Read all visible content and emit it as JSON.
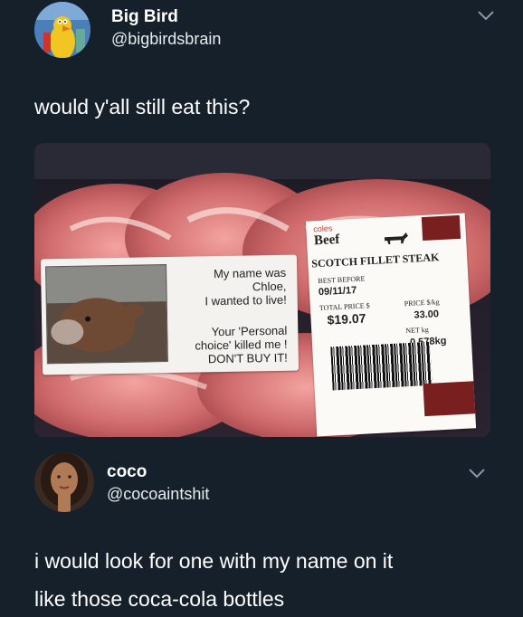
{
  "tweet1": {
    "name": "Big Bird",
    "handle": "@bigbirdsbrain",
    "text": "would y'all still eat this?",
    "avatar_icon": "big-bird-avatar-icon"
  },
  "photo": {
    "left_label": {
      "line1": "My name was",
      "line2": "Chloe,",
      "line3": "I wanted to live!",
      "line4": "Your 'Personal",
      "line5": "choice' killed me !",
      "line6": "DON'T BUY IT!"
    },
    "right_label": {
      "brand": "coles",
      "beef": "Beef",
      "product": "SCOTCH FILLET STEAK",
      "best_before_label": "BEST BEFORE",
      "best_before_date": "09/11/17",
      "total_price_label": "TOTAL PRICE $",
      "total_price": "$19.07",
      "price_per_kg_label": "PRICE $/kg",
      "price_per_kg": "33.00",
      "net_kg_label": "NET kg",
      "net_kg": "0.578kg"
    }
  },
  "tweet2": {
    "name": "coco",
    "handle": "@cocoaintshit",
    "text_line1": "i would look for one with my name on it",
    "text_line2": "like those coca-cola bottles",
    "avatar_icon": "coco-avatar-icon"
  },
  "colors": {
    "background": "#15202b",
    "text": "#ffffff"
  }
}
